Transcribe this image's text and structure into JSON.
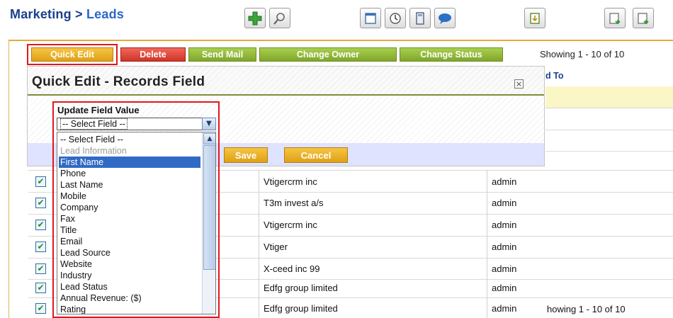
{
  "breadcrumb": {
    "module": "Marketing",
    "separator": ">",
    "current": "Leads"
  },
  "toolbar_icons": [
    "add-icon",
    "search-icon",
    "calendar-icon",
    "clock-icon",
    "calculator-icon",
    "chat-icon",
    "import-icon",
    "export-icon",
    "export-selected-icon"
  ],
  "actions": {
    "quick_edit": "Quick Edit",
    "delete": "Delete",
    "send_mail": "Send Mail",
    "change_owner": "Change Owner",
    "change_status": "Change Status"
  },
  "showing": "Showing 1 - 10 of 10",
  "showing_bottom": "howing 1 - 10 of 10",
  "column_fragment": "d To",
  "dialog": {
    "title": "Quick Edit - Records Field",
    "close_symbol": "×",
    "field_label": "Update Field Value",
    "selected_value": "-- Select Field --",
    "save": "Save",
    "cancel": "Cancel"
  },
  "dropdown_options": [
    "-- Select Field --",
    "Lead Information",
    "First Name",
    "Phone",
    "Last Name",
    "Mobile",
    "Company",
    "Fax",
    "Title",
    "Email",
    "Lead Source",
    "Website",
    "Industry",
    "Lead Status",
    "Annual Revenue: ($)",
    "Rating"
  ],
  "rows": [
    {
      "checked": true,
      "company": "Vtigercrm inc",
      "owner": "admin"
    },
    {
      "checked": true,
      "company": "T3m invest a/s",
      "owner": "admin"
    },
    {
      "checked": true,
      "company": "Vtigercrm inc",
      "owner": "admin"
    },
    {
      "checked": true,
      "company": "Vtiger",
      "owner": "admin"
    },
    {
      "checked": true,
      "company": "X-ceed inc 99",
      "owner": "admin"
    },
    {
      "checked": true,
      "company": "Edfg group limited",
      "owner": "admin"
    },
    {
      "checked": true,
      "company": "Edfg group limited",
      "owner": "admin"
    }
  ],
  "check_symbol": "✔",
  "colors": {
    "accent_orange": "#e5a93a",
    "button_green": "#8cb536",
    "button_red": "#dd4436",
    "highlight_red": "#e0181e",
    "selection_blue": "#316ac5"
  }
}
